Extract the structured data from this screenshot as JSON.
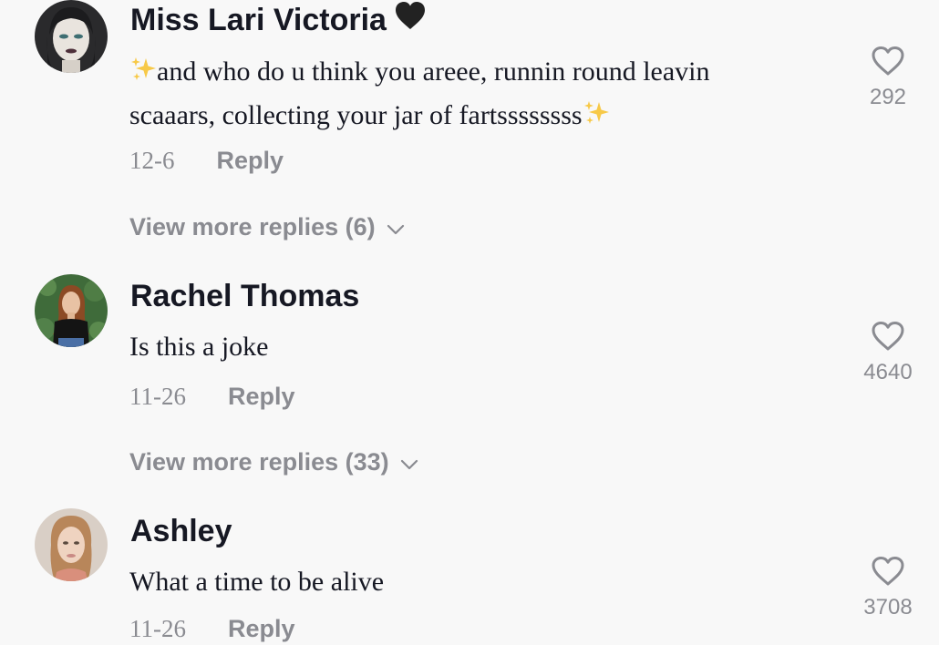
{
  "comments": [
    {
      "username": "Miss Lari Victoria",
      "username_emoji": "black-heart",
      "text": "and who do u think you areee, runnin round leavin scaaars, collecting your jar of fartssssssss",
      "date": "12-6",
      "reply_label": "Reply",
      "likes": "292",
      "view_more": "View more replies (6)"
    },
    {
      "username": "Rachel Thomas",
      "text": "Is this a joke",
      "date": "11-26",
      "reply_label": "Reply",
      "likes": "4640",
      "view_more": "View more replies (33)"
    },
    {
      "username": "Ashley",
      "text": "What a time to be alive",
      "date": "11-26",
      "reply_label": "Reply",
      "likes": "3708"
    }
  ],
  "colors": {
    "background": "#f8f8f8",
    "primary_text": "#161823",
    "secondary_text": "#8a8b91",
    "sparkle": "#f7c948"
  }
}
